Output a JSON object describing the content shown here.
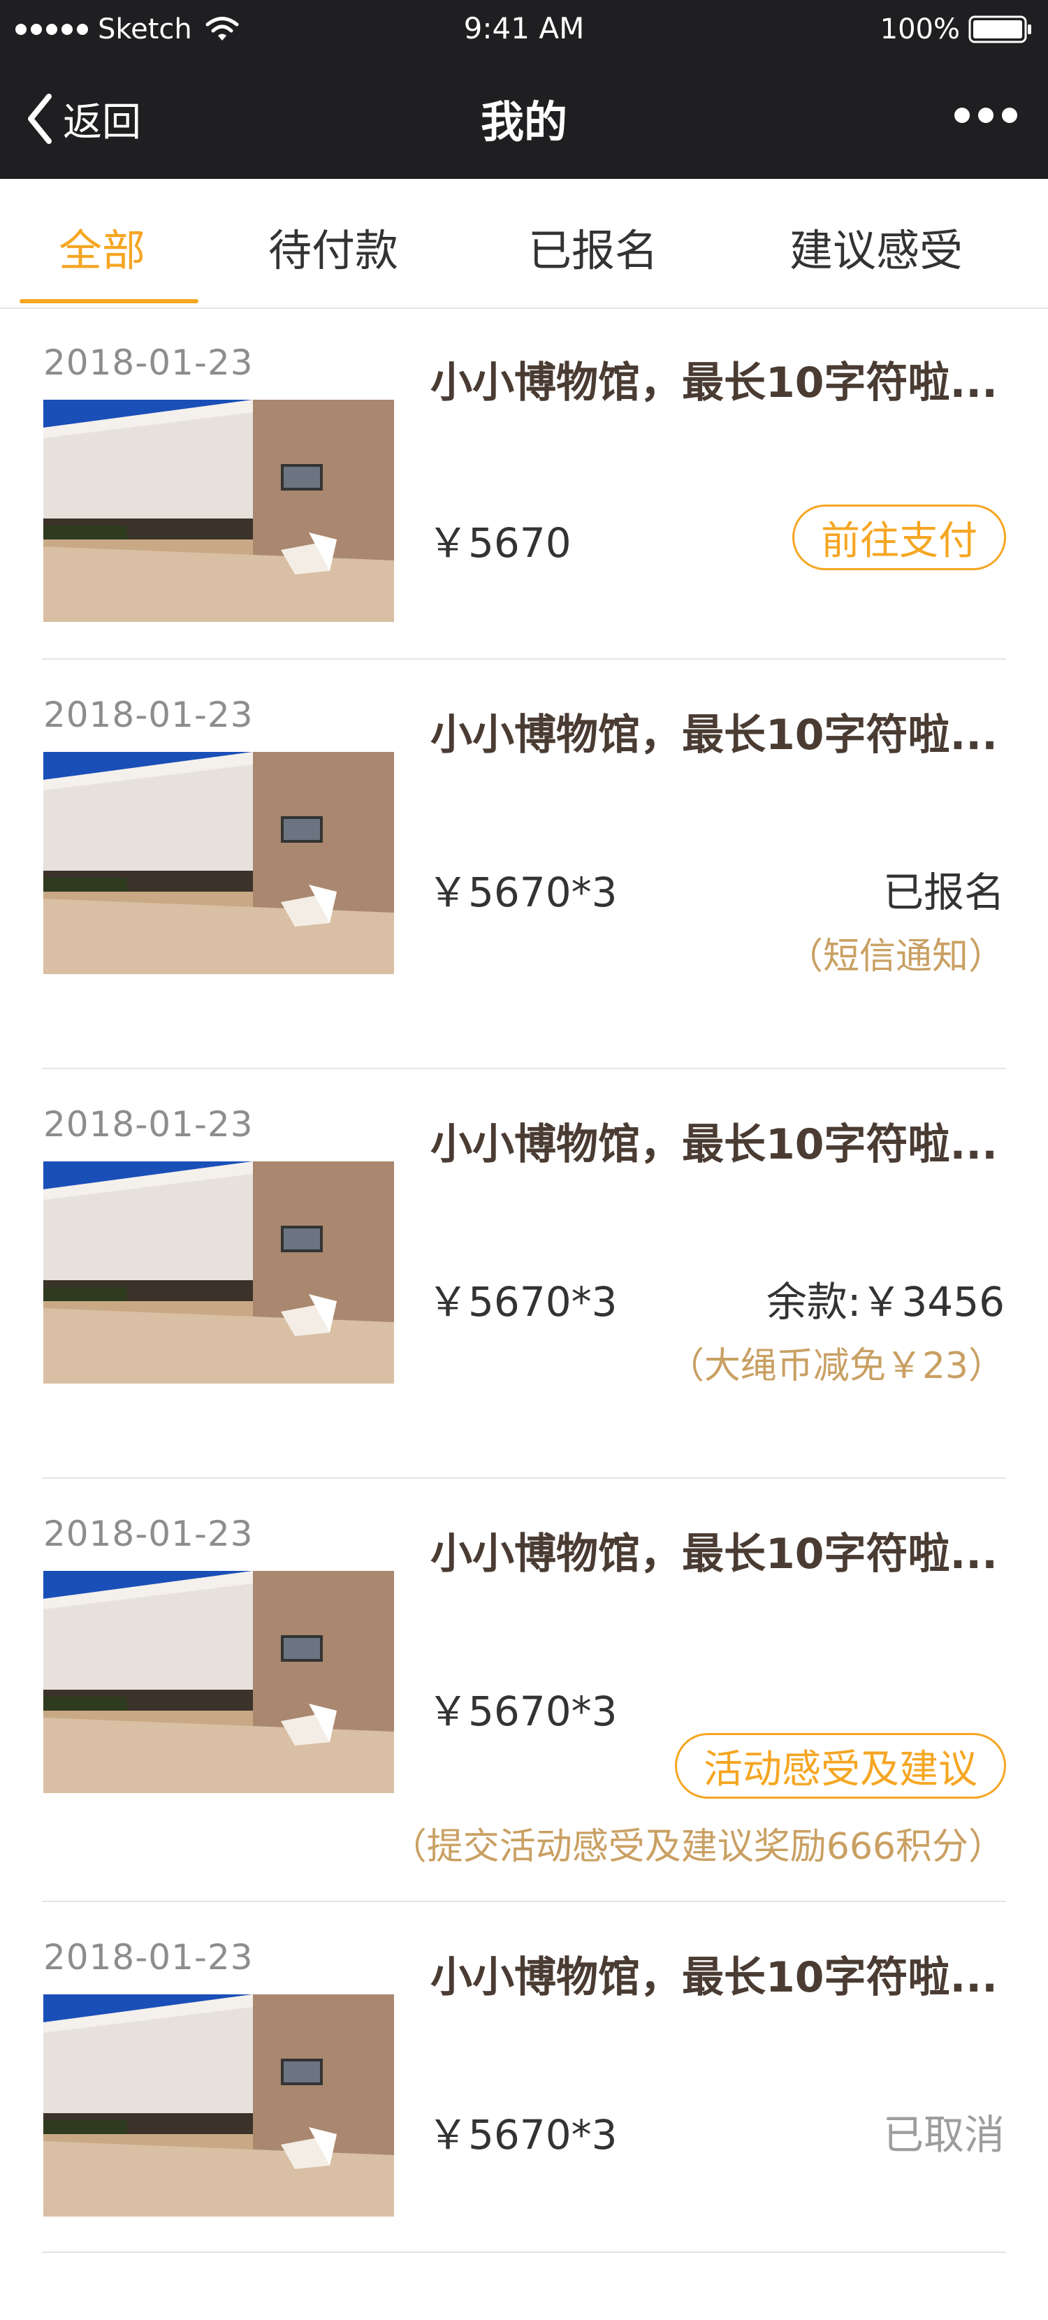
{
  "status_bar": {
    "carrier": "Sketch",
    "time": "9:41 AM",
    "battery": "100%"
  },
  "nav": {
    "back_label": "返回",
    "title": "我的"
  },
  "tabs": [
    {
      "label": "全部",
      "active": true
    },
    {
      "label": "待付款",
      "active": false
    },
    {
      "label": "已报名",
      "active": false
    },
    {
      "label": "建议感受",
      "active": false
    }
  ],
  "orders": [
    {
      "date": "2018-01-23",
      "title": "小小博物馆，最长10字符啦...",
      "price": "￥5670",
      "action_label": "前往支付"
    },
    {
      "date": "2018-01-23",
      "title": "小小博物馆，最长10字符啦...",
      "price": "￥5670*3",
      "status": "已报名",
      "note": "（短信通知）"
    },
    {
      "date": "2018-01-23",
      "title": "小小博物馆，最长10字符啦...",
      "price": "￥5670*3",
      "status": "余款:￥3456",
      "note": "（大绳币减免￥23）"
    },
    {
      "date": "2018-01-23",
      "title": "小小博物馆，最长10字符啦...",
      "price": "￥5670*3",
      "action_label": "活动感受及建议",
      "note": "（提交活动感受及建议奖励666积分）"
    },
    {
      "date": "2018-01-23",
      "title": "小小博物馆，最长10字符啦...",
      "price": "￥5670*3",
      "status": "已取消"
    }
  ],
  "colors": {
    "accent": "#f5a623",
    "note": "#c9a063",
    "dark_bar": "#1f1f21",
    "muted": "#9d9d9d"
  },
  "icons": [
    "wifi-icon",
    "battery-icon",
    "back-chevron-icon",
    "more-icon",
    "museum-thumbnail"
  ]
}
